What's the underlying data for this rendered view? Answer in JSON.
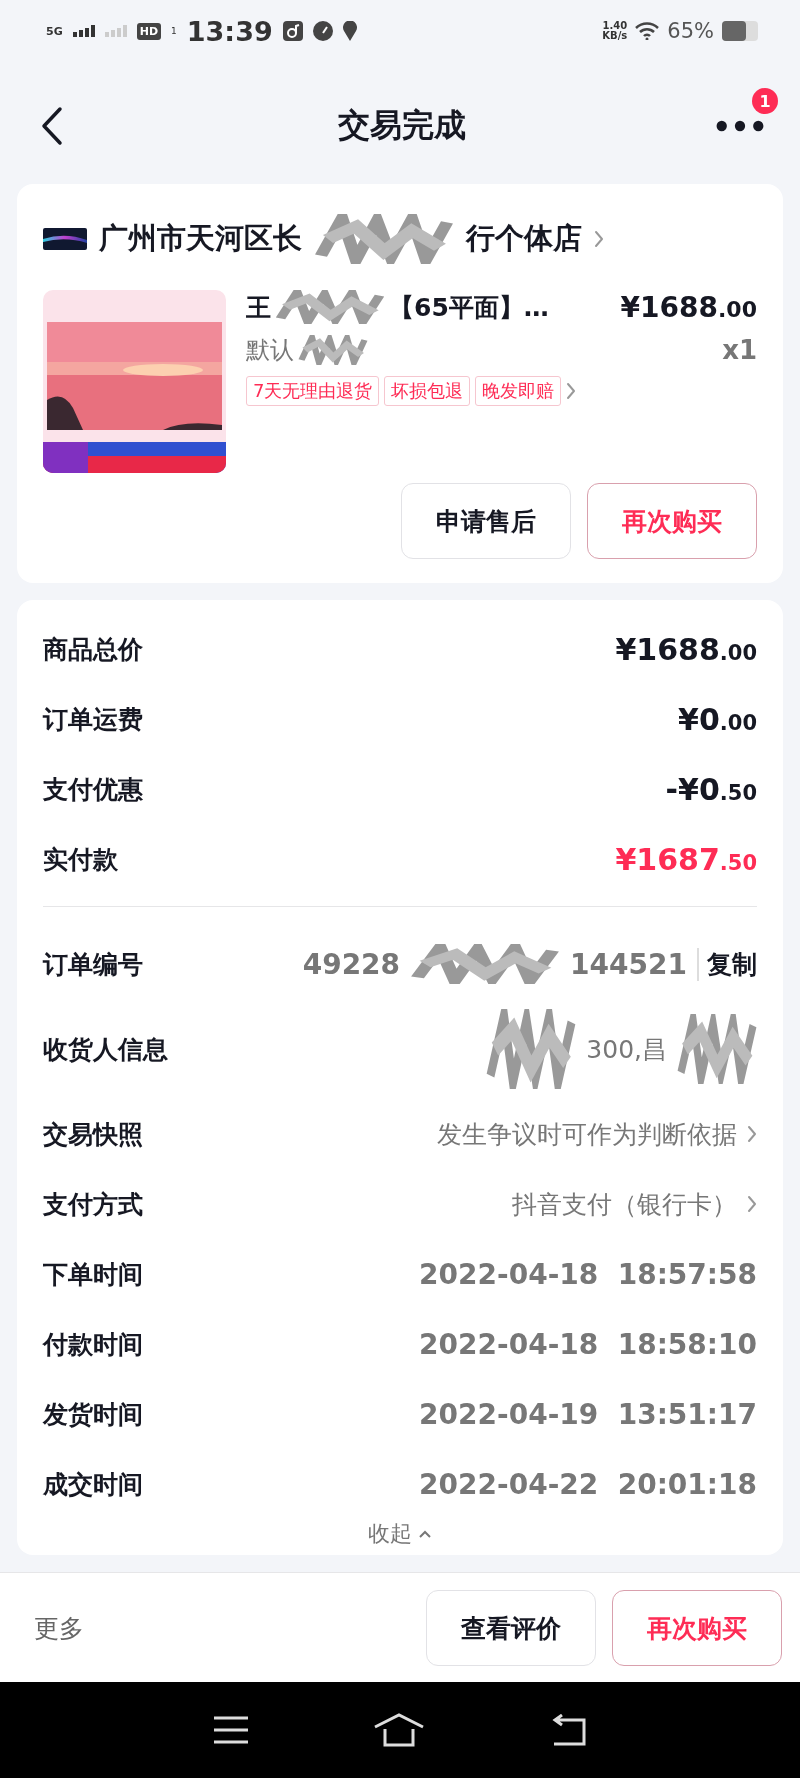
{
  "status_bar": {
    "network": "5G",
    "hd": "HD",
    "sim": "1",
    "time": "13:39",
    "speed": "1.40",
    "speed_unit": "KB/s",
    "battery": "65%"
  },
  "header": {
    "title": "交易完成",
    "badge": "1"
  },
  "shop": {
    "name_start": "广州市天河区长",
    "name_end": "行个体店"
  },
  "product": {
    "title_start": "王",
    "title_end": "【65平面】…",
    "price_main": "¥1688",
    "price_decimal": ".00",
    "spec": "默认",
    "quantity": "x1",
    "tags": [
      "7天无理由退货",
      "坏损包退",
      "晚发即赔"
    ]
  },
  "card_actions": [
    {
      "label": "申请售后",
      "primary": false
    },
    {
      "label": "再次购买",
      "primary": true
    }
  ],
  "price_rows": [
    {
      "label": "商品总价",
      "main": "¥1688",
      "decimal": ".00",
      "highlight": false
    },
    {
      "label": "订单运费",
      "main": "¥0",
      "decimal": ".00",
      "highlight": false
    },
    {
      "label": "支付优惠",
      "main": "-¥0",
      "decimal": ".50",
      "highlight": false
    },
    {
      "label": "实付款",
      "main": "¥1687",
      "decimal": ".50",
      "highlight": true
    }
  ],
  "info_rows": [
    {
      "kind": "copy",
      "label": "订单编号",
      "value_start": "49228",
      "value_end": "144521",
      "action": "复制"
    },
    {
      "kind": "redacted",
      "label": "收货人信息",
      "value": "300,昌"
    },
    {
      "kind": "link",
      "label": "交易快照",
      "value": "发生争议时可作为判断依据"
    },
    {
      "kind": "link",
      "label": "支付方式",
      "value": "抖音支付（银行卡）"
    },
    {
      "kind": "plain",
      "label": "下单时间",
      "value": "2022-04-18  18:57:58"
    },
    {
      "kind": "plain",
      "label": "付款时间",
      "value": "2022-04-18  18:58:10"
    },
    {
      "kind": "plain",
      "label": "发货时间",
      "value": "2022-04-19  13:51:17"
    },
    {
      "kind": "plain",
      "label": "成交时间",
      "value": "2022-04-22  20:01:18"
    }
  ],
  "collapse": "收起",
  "footer": {
    "more": "更多",
    "buttons": [
      {
        "label": "查看评价",
        "primary": false
      },
      {
        "label": "再次购买",
        "primary": true
      }
    ]
  }
}
